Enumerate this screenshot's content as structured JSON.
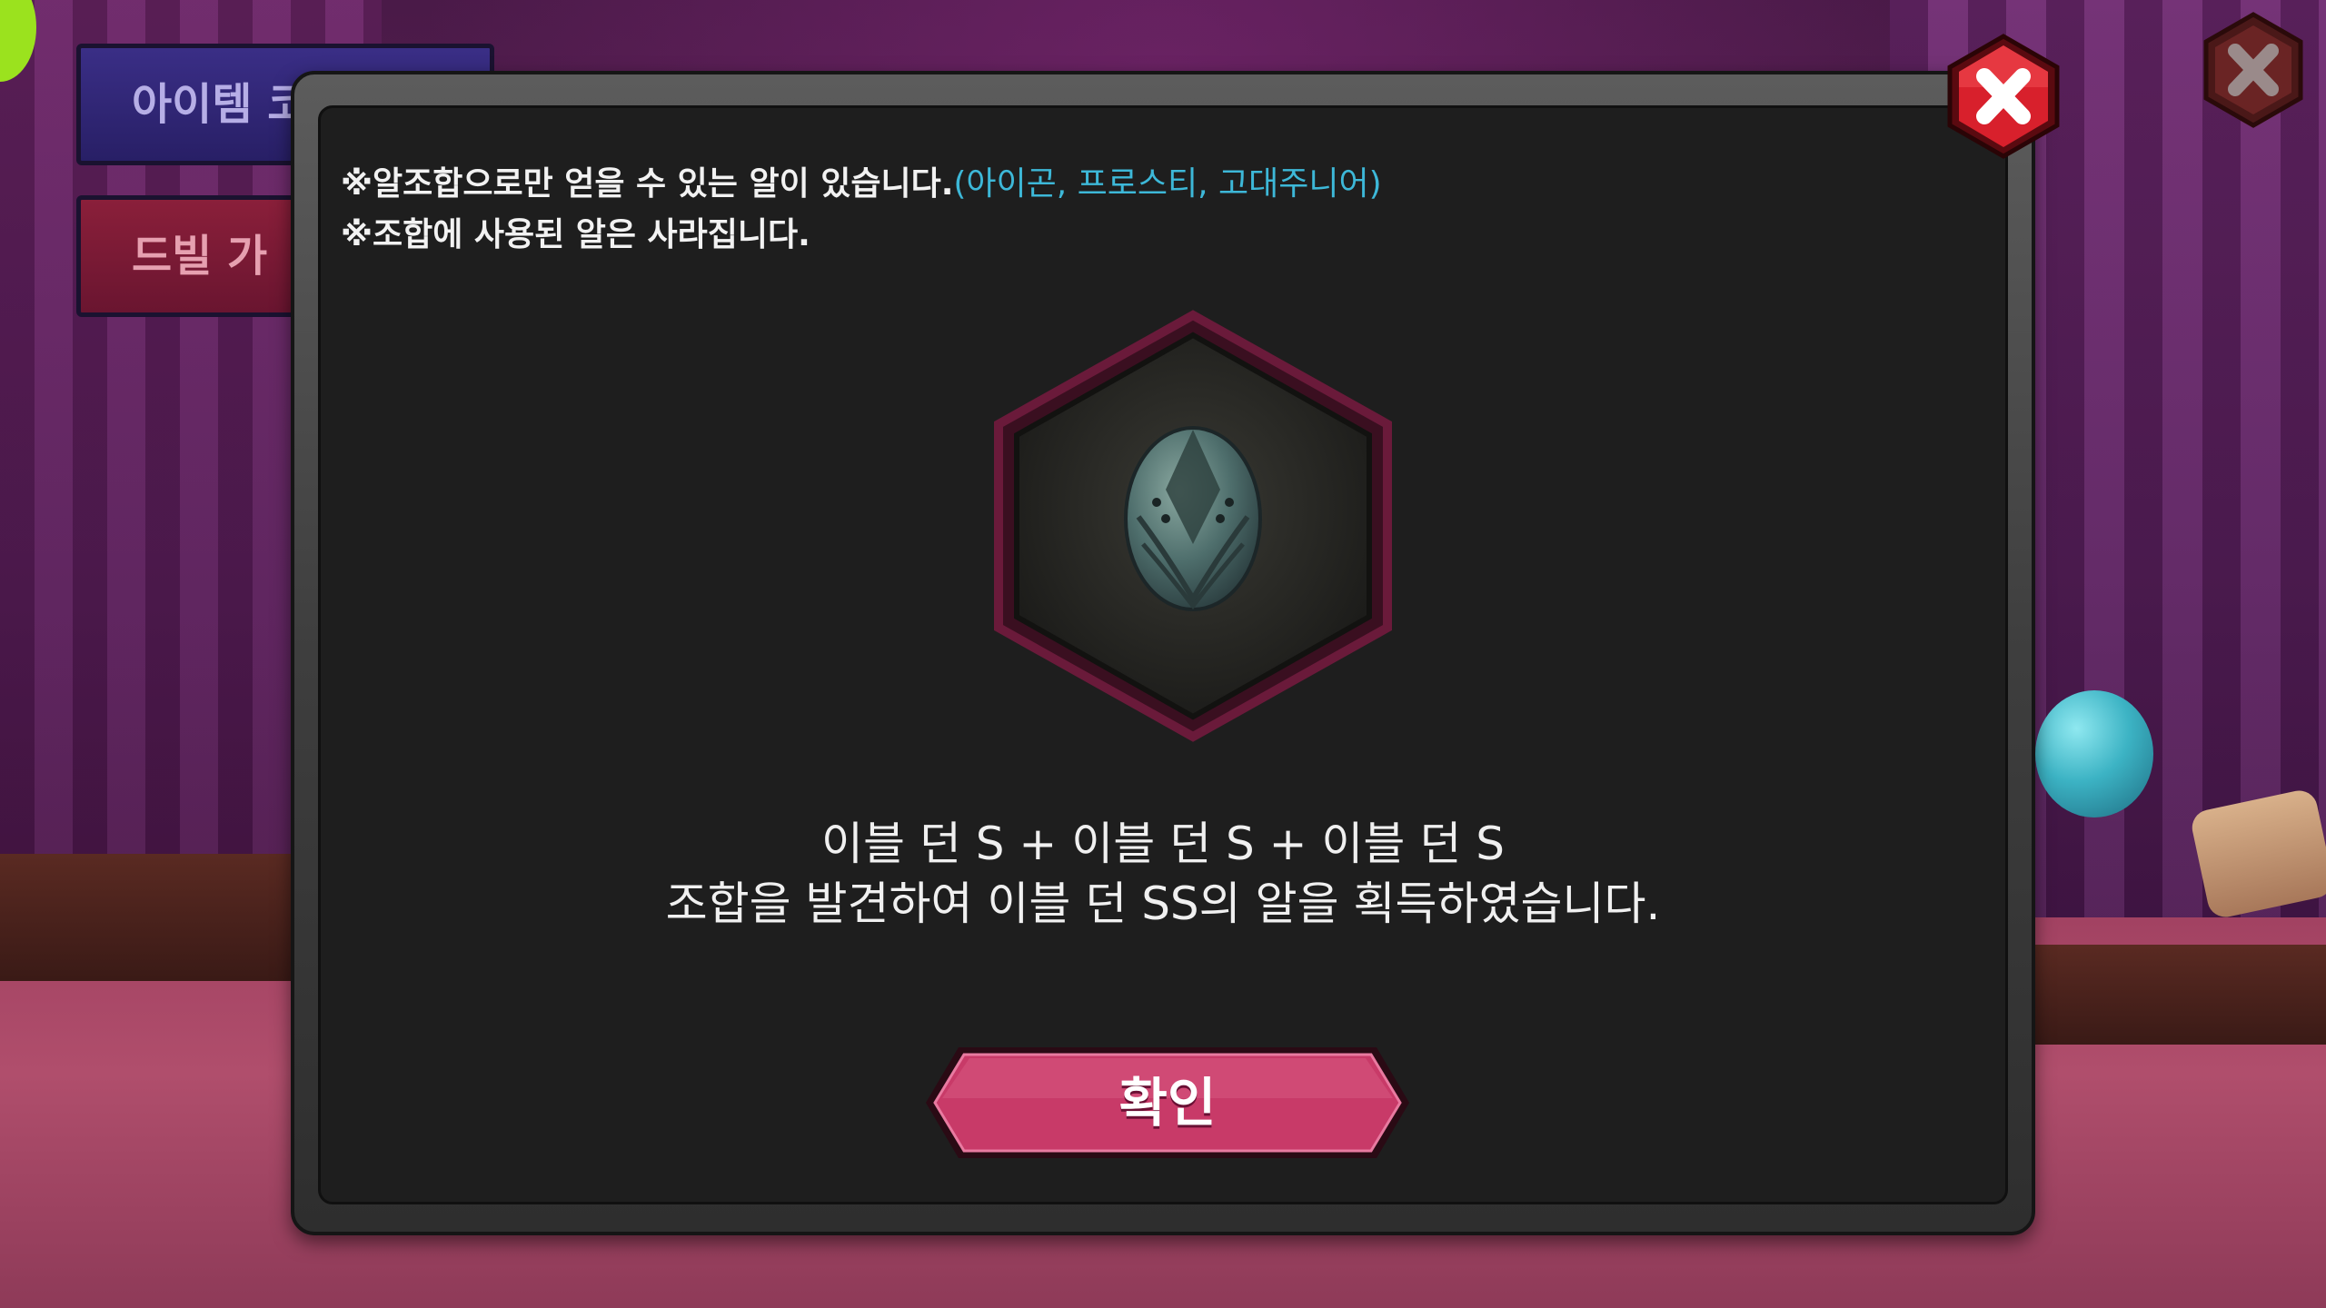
{
  "background": {
    "item_tab_label": "아이템 코",
    "drill_tab_label": "드빌 가"
  },
  "modal": {
    "notice_line1_prefix": "※알조합으로만 얻을 수 있는 알이 있습니다.",
    "notice_line1_highlight": "(아이곤, 프로스티, 고대주니어)",
    "notice_line2": "※조합에 사용된 알은 사라집니다.",
    "result_line1": "이블 던 S + 이블 던 S + 이블 던 S",
    "result_line2": "조합을 발견하여 이블 던 SS의 알을 획득하였습니다.",
    "confirm_label": "확인",
    "egg_icon": "dark-egg-icon",
    "close_icon": "close-x-icon"
  },
  "colors": {
    "highlight_text": "#3db8d8",
    "confirm_button": "#c83a68",
    "close_button": "#d8202c",
    "badge_border": "#6a1a3a"
  }
}
